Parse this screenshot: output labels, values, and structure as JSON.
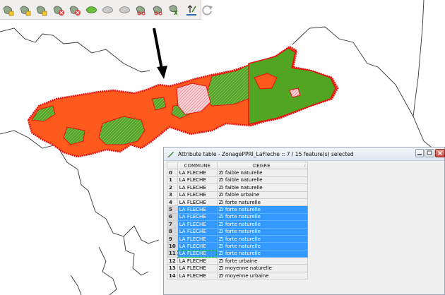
{
  "colors": {
    "zone_fill": "#ff5a1e",
    "zone_border": "#e81010",
    "zone_green": "#52a522",
    "zone_pink": "#f4c2cc",
    "selection": "#3399ff",
    "boundary": "#333333"
  },
  "toolbar": {
    "icons": [
      "add-feature-icon",
      "move-feature-icon",
      "node-tool-icon",
      "delete-ring-icon",
      "delete-part-icon",
      "reshape-icon",
      "simplify-icon",
      "split-features-icon",
      "split-parts-icon",
      "merge-features-icon",
      "merge-attributes-icon",
      "rotate-point-icon",
      "redo-icon"
    ]
  },
  "attribute_table": {
    "title": "Attribute table - ZonagePPRI_LaFleche :: 7 / 15 feature(s) selected",
    "columns": [
      "COMMUNE",
      "DEGRE"
    ],
    "rows": [
      {
        "id": "0",
        "commune": "LA FLECHE",
        "degre": "ZI faible naturelle",
        "selected": false
      },
      {
        "id": "1",
        "commune": "LA FLECHE",
        "degre": "ZI faible naturelle",
        "selected": false
      },
      {
        "id": "2",
        "commune": "LA FLECHE",
        "degre": "ZI faible naturelle",
        "selected": false
      },
      {
        "id": "3",
        "commune": "LA FLECHE",
        "degre": "ZI faible urbaine",
        "selected": false
      },
      {
        "id": "4",
        "commune": "LA FLECHE",
        "degre": "ZI forte naturelle",
        "selected": false
      },
      {
        "id": "5",
        "commune": "LA FLECHE",
        "degre": "ZI forte naturelle",
        "selected": true
      },
      {
        "id": "6",
        "commune": "LA FLECHE",
        "degre": "ZI forte naturelle",
        "selected": true
      },
      {
        "id": "7",
        "commune": "LA FLECHE",
        "degre": "ZI forte naturelle",
        "selected": true
      },
      {
        "id": "8",
        "commune": "LA FLECHE",
        "degre": "ZI forte naturelle",
        "selected": true
      },
      {
        "id": "9",
        "commune": "LA FLECHE",
        "degre": "ZI forte naturelle",
        "selected": true
      },
      {
        "id": "10",
        "commune": "LA FLECHE",
        "degre": "ZI forte naturelle",
        "selected": true
      },
      {
        "id": "11",
        "commune": "LA FLECHE",
        "degre": "ZI forte naturelle",
        "selected": true
      },
      {
        "id": "12",
        "commune": "LA FLECHE",
        "degre": "ZI forte urbaine",
        "selected": false
      },
      {
        "id": "13",
        "commune": "LA FLECHE",
        "degre": "ZI moyenne naturelle",
        "selected": false
      },
      {
        "id": "14",
        "commune": "LA FLECHE",
        "degre": "ZI moyenne urbaine",
        "selected": false
      }
    ]
  }
}
